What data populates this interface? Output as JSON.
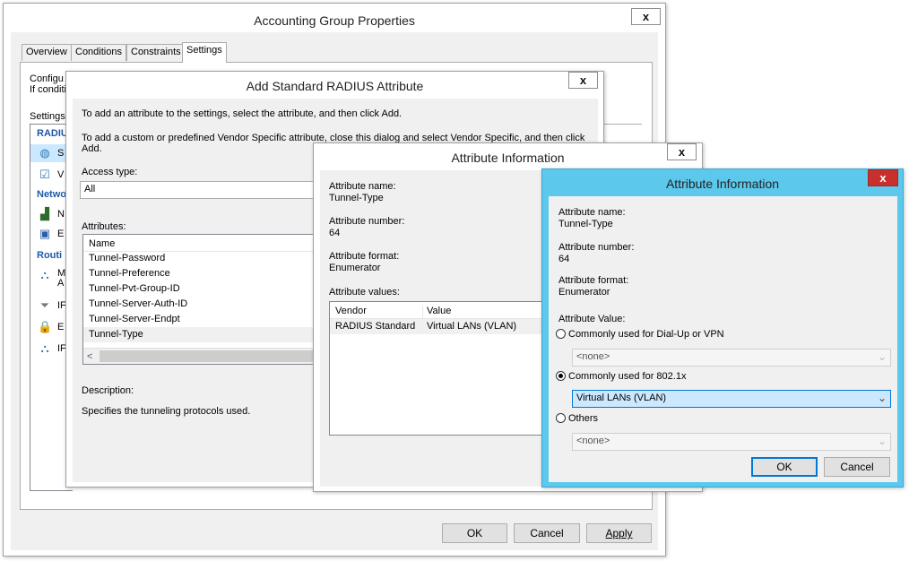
{
  "accounting": {
    "title": "Accounting Group Properties",
    "tabs": [
      "Overview",
      "Conditions",
      "Constraints",
      "Settings"
    ],
    "intro_line1": "Configu",
    "intro_line2": "If conditi",
    "settings_label": "Settings:",
    "sidebar": {
      "radius_header": "RADIU",
      "item_s": "S",
      "item_v": "V",
      "network_header": "Netwo",
      "item_n": "N",
      "item_e": "E",
      "routing_header": "Routi",
      "item_m1": "M",
      "item_m2": "A",
      "item_ip": "IF",
      "item_e2": "E",
      "item_ip2": "IF"
    },
    "buttons": {
      "ok": "OK",
      "cancel": "Cancel",
      "apply": "Apply"
    }
  },
  "add_radius": {
    "title": "Add Standard RADIUS Attribute",
    "instr1": "To add an attribute to the settings, select the attribute, and then click Add.",
    "instr2_line1": "To add a custom or predefined Vendor Specific attribute, close this dialog and select Vendor Specific, and then click",
    "instr2_line2": "Add.",
    "access_type_label": "Access type:",
    "access_type_value": "All",
    "attributes_label": "Attributes:",
    "col_name": "Name",
    "attributes": [
      "Tunnel-Password",
      "Tunnel-Preference",
      "Tunnel-Pvt-Group-ID",
      "Tunnel-Server-Auth-ID",
      "Tunnel-Server-Endpt",
      "Tunnel-Type"
    ],
    "description_label": "Description:",
    "description_text": "Specifies the tunneling protocols used."
  },
  "attr_info_back": {
    "title": "Attribute Information",
    "name_label": "Attribute name:",
    "name_value": "Tunnel-Type",
    "number_label": "Attribute number:",
    "number_value": "64",
    "format_label": "Attribute format:",
    "format_value": "Enumerator",
    "values_label": "Attribute values:",
    "col_vendor": "Vendor",
    "col_value": "Value",
    "row_vendor": "RADIUS Standard",
    "row_value": "Virtual LANs (VLAN)"
  },
  "attr_info_front": {
    "title": "Attribute Information",
    "name_label": "Attribute name:",
    "name_value": "Tunnel-Type",
    "number_label": "Attribute number:",
    "number_value": "64",
    "format_label": "Attribute format:",
    "format_value": "Enumerator",
    "value_label": "Attribute Value:",
    "radio_dialup": "Commonly used for Dial-Up or VPN",
    "combo_dialup": "<none>",
    "radio_8021x": "Commonly used for 802.1x",
    "combo_8021x": "Virtual LANs (VLAN)",
    "radio_others": "Others",
    "combo_others": "<none>",
    "ok": "OK",
    "cancel": "Cancel"
  },
  "icons": {
    "close": "x",
    "arrow": "⌄",
    "scroll_left": "<"
  },
  "colors": {
    "active_title": "#5bc8ec",
    "close_red": "#c7302c",
    "combo_highlight": "#cce8ff"
  }
}
